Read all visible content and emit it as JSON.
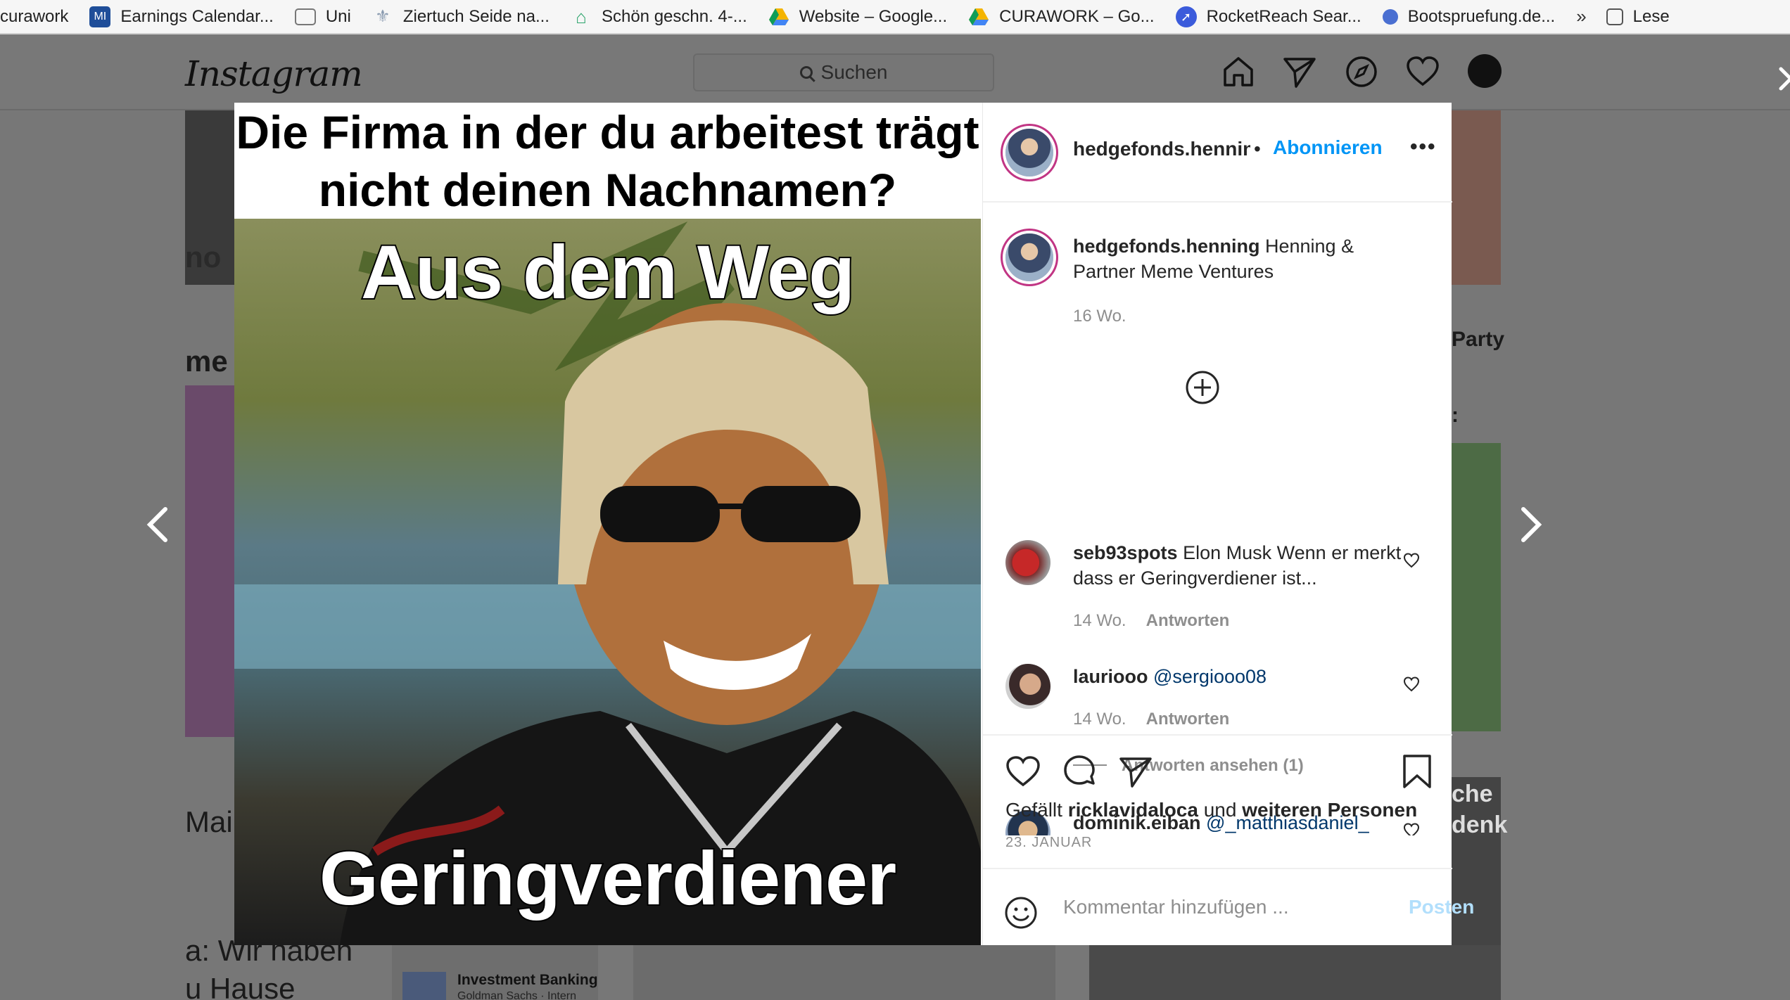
{
  "bookmarks": {
    "items": [
      {
        "label": "curawork",
        "icon": "none",
        "color": ""
      },
      {
        "label": "Earnings Calendar...",
        "icon": "mi-logo-icon",
        "color": "#1f4e99"
      },
      {
        "label": "Uni",
        "icon": "folder-icon",
        "color": "#888888"
      },
      {
        "label": "Ziertuch Seide na...",
        "icon": "fleur-icon",
        "color": "#8a9bb0"
      },
      {
        "label": "Schön geschn. 4-...",
        "icon": "house-icon",
        "color": "#2aa36a"
      },
      {
        "label": "Website – Google...",
        "icon": "google-drive-icon",
        "color": "#f4b400"
      },
      {
        "label": "CURAWORK – Go...",
        "icon": "google-drive-icon",
        "color": "#0f9d58"
      },
      {
        "label": "RocketReach Sear...",
        "icon": "rocket-icon",
        "color": "#3b5bdb"
      },
      {
        "label": "Bootspruefung.de...",
        "icon": "boat-icon",
        "color": "#4a6fd1"
      }
    ],
    "overflow": "»",
    "reading_list": "Lese"
  },
  "header": {
    "logo": "Instagram",
    "search_placeholder": "Suchen"
  },
  "background": {
    "texts": [
      "no",
      "me",
      "Party",
      ":",
      "Mai",
      "a: Wir haben",
      "u Hause",
      "che",
      "denk"
    ],
    "ad_title": "Investment Banking",
    "ad_sub": "Goldman Sachs · Intern"
  },
  "post": {
    "meme_top": "Die Firma in der du arbeitest trägt nicht deinen Nachnamen?",
    "caption_top": "Aus dem Weg",
    "caption_bottom": "Geringverdiener",
    "author": "hedgefonds.henning",
    "follow_label": "Abonnieren",
    "bullet": "•",
    "more": "•••",
    "description": {
      "user": "hedgefonds.henning",
      "text": "Henning & Partner Meme Ventures",
      "time": "16 Wo."
    },
    "comments": [
      {
        "user": "seb93spots",
        "text": "Elon Musk Wenn er merkt dass er Geringverdiener ist...",
        "time": "14 Wo.",
        "reply": "Antworten"
      },
      {
        "user": "lauriooo",
        "text": "@sergiooo08",
        "time": "14 Wo.",
        "reply": "Antworten",
        "view_replies": "Antworten ansehen (1)"
      },
      {
        "user": "dominik.eiban",
        "text": "@_matthiasdaniel_"
      }
    ],
    "likes_prefix": "Gefällt",
    "likes_user": "ricklavidaloca",
    "likes_and": "und",
    "likes_others": "weiteren Personen",
    "date": "23. JANUAR",
    "comment_placeholder": "Kommentar hinzufügen ...",
    "post_button": "Posten"
  },
  "colors": {
    "accent": "#0095f6",
    "post_disabled": "#b2dffc"
  }
}
